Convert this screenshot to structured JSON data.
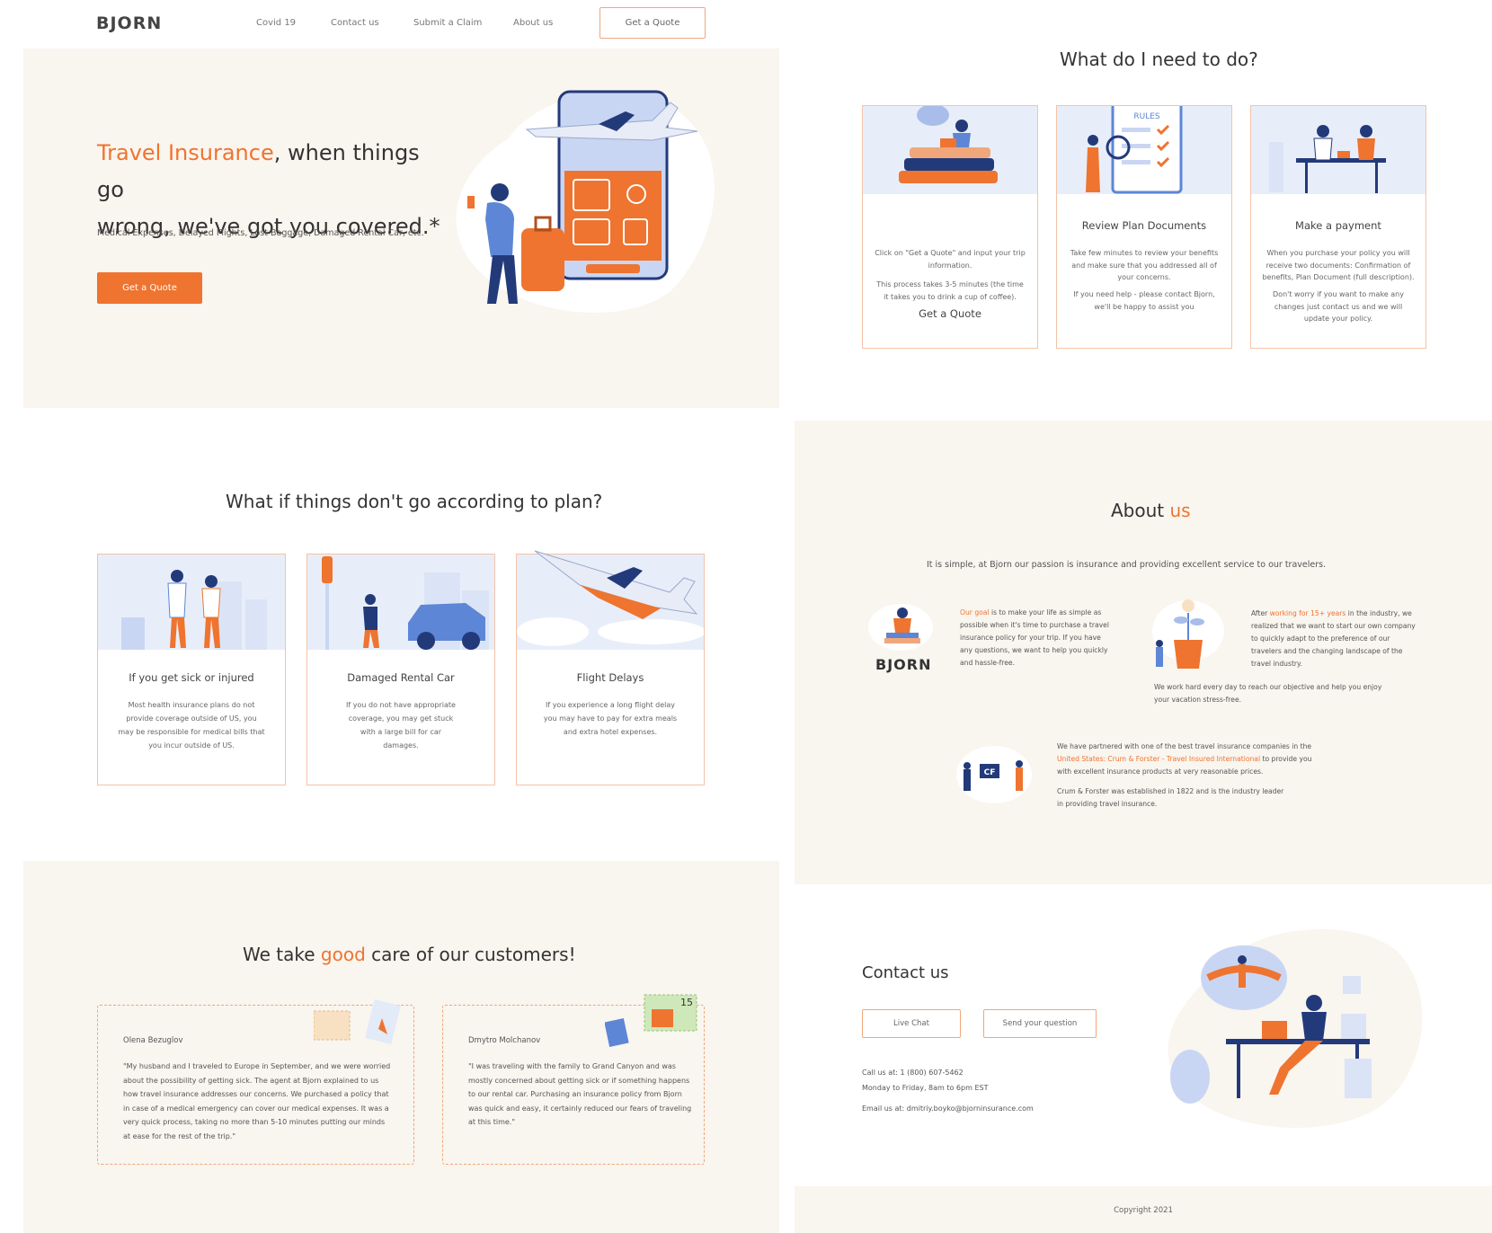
{
  "header": {
    "logo": "BJORN",
    "nav": [
      "Covid 19",
      "Contact us",
      "Submit a Claim",
      "About us"
    ],
    "quote_button": "Get a Quote"
  },
  "hero": {
    "title_highlight": "Travel Insurance",
    "title_rest_line1": ", when things go",
    "title_line2": "wrong, we've got you covered.*",
    "subtitle": "Medical Expenses, Delayed Flights, Lost Baggage, Damaged Rental Car, etc.",
    "cta": "Get a Quote"
  },
  "steps": {
    "title": "What do I need to do?",
    "cards": [
      {
        "title": "Get a Quote",
        "text1": "Click on \"Get a Quote\" and input your trip information.",
        "text2": "This process takes 3-5 minutes (the time it takes you to drink a cup of coffee)."
      },
      {
        "title": "Review Plan Documents",
        "text1": "Take few minutes to review your benefits and make sure that you addressed all of your concerns.",
        "text2": "If you need help - please contact Bjorn, we'll be happy to assist you"
      },
      {
        "title": "Make a payment",
        "text1": "When you purchase your policy you will receive two documents: Confirmation of benefits, Plan Document (full description).",
        "text2": "Don't worry if you want to make any changes just contact us and we will update your policy."
      }
    ],
    "rules_label": "RULES"
  },
  "plan": {
    "title": "What if things don't go according to plan?",
    "cards": [
      {
        "title": "If you get sick or injured",
        "text": "Most health insurance plans do not provide coverage outside of US, you may be responsible for medical bills that you incur outside of US."
      },
      {
        "title": "Damaged Rental Car",
        "text": "If you do not have appropriate coverage, you may get stuck with a large bill for car damages."
      },
      {
        "title": "Flight Delays",
        "text": "If you experience a long flight delay you may have to pay for extra meals and extra hotel expenses."
      }
    ]
  },
  "testimonials": {
    "title_before": "We take ",
    "title_highlight": "good",
    "title_after": " care of our customers!",
    "items": [
      {
        "name": "Olena Bezuglov",
        "text": "\"My husband and I traveled to Europe in September, and we were worried about the possibility of getting sick. The agent at Bjorn explained to us how travel insurance addresses our concerns. We purchased a policy that in case of a medical emergency can cover our medical expenses. It was a very quick process, taking no more than 5-10 minutes putting our minds at ease for the rest of the trip.\""
      },
      {
        "name": "Dmytro Molchanov",
        "text": "\"I was traveling with the family to Grand Canyon and was mostly concerned about getting sick or if something happens to our rental car. Purchasing an insurance policy from Bjorn was quick and easy, it certainly reduced our fears of traveling at this time.\""
      }
    ],
    "stamp_label": "15"
  },
  "about": {
    "title_before": "About ",
    "title_highlight": "us",
    "intro": "It is simple, at Bjorn our passion is insurance and providing excellent service to our travelers.",
    "logo": "BJORN",
    "badge": "CF",
    "goal_highlight": "Our goal",
    "goal_text": " is to make your life as simple as possible when it's time to purchase a travel insurance policy for your trip. If you have any questions, we want to help you quickly and hassle-free.",
    "years_before": "After ",
    "years_highlight": "working for 15+ years",
    "years_after": " in the industry, we realized that we want to start our own company to quickly adapt to the preference of our travelers and the changing landscape of the travel industry.",
    "work_hard": "We work hard every day to reach our objective and help you enjoy your vacation stress-free.",
    "partner_before": "We have partnered with one of the best travel insurance companies in the ",
    "partner_highlight": "United States: Crum & Forster - Travel Insured International",
    "partner_after": " to provide you with excellent insurance products at very reasonable prices.",
    "established": "Crum & Forster was established in 1822 and is the industry leader in providing travel insurance."
  },
  "contact": {
    "title": "Contact us",
    "live_chat": "Live Chat",
    "send_question": "Send your question",
    "phone": "Call us at: 1 (800) 607-5462",
    "hours": "Monday to Friday, 8am to 6pm EST",
    "email": "Email us at: dmitriy.boyko@bjorninsurance.com"
  },
  "footer": {
    "copyright": "Copyright 2021"
  },
  "colors": {
    "accent": "#ee7430",
    "cream": "#f9f5ef",
    "navy": "#233a7a",
    "light_blue": "#c9d6f3"
  }
}
